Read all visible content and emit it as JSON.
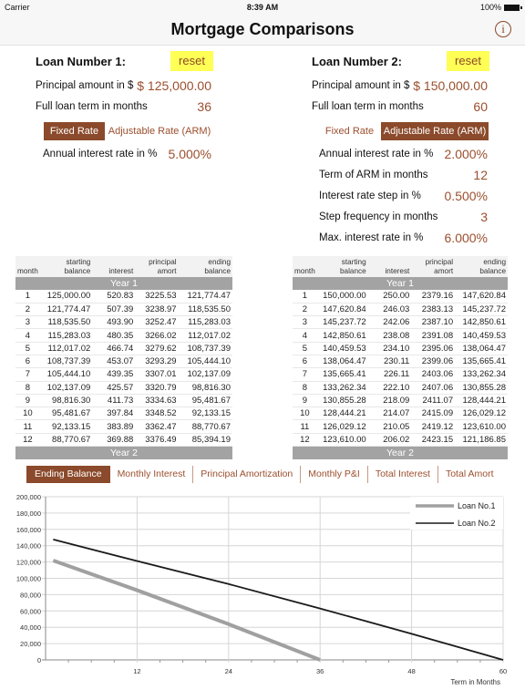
{
  "status_bar": {
    "carrier": "Carrier",
    "time": "8:39 AM",
    "battery": "100%"
  },
  "nav": {
    "title": "Mortgage Comparisons",
    "info_icon": "info-icon"
  },
  "loans": [
    {
      "title": "Loan Number 1:",
      "reset_label": "reset",
      "principal_label": "Principal amount in $",
      "principal_value": "$ 125,000.00",
      "term_label": "Full loan term in months",
      "term_value": "36",
      "rate_types": [
        "Fixed Rate",
        "Adjustable Rate (ARM)"
      ],
      "selected_rate_type": "Fixed Rate",
      "fields": [
        {
          "label": "Annual interest rate in %",
          "value": "5.000%"
        }
      ]
    },
    {
      "title": "Loan Number 2:",
      "reset_label": "reset",
      "principal_label": "Principal amount in $",
      "principal_value": "$ 150,000.00",
      "term_label": "Full loan term in months",
      "term_value": "60",
      "rate_types": [
        "Fixed Rate",
        "Adjustable Rate (ARM)"
      ],
      "selected_rate_type": "Adjustable Rate (ARM)",
      "fields": [
        {
          "label": "Annual interest rate in %",
          "value": "2.000%"
        },
        {
          "label": "Term of ARM in months",
          "value": "12"
        },
        {
          "label": "Interest rate step in %",
          "value": "0.500%"
        },
        {
          "label": "Step frequency in months",
          "value": "3"
        },
        {
          "label": "Max. interest rate in %",
          "value": "6.000%"
        }
      ]
    }
  ],
  "table_headers": [
    [
      "",
      "month"
    ],
    [
      "starting",
      "balance"
    ],
    [
      "",
      "interest"
    ],
    [
      "principal",
      "amort"
    ],
    [
      "ending",
      "balance"
    ]
  ],
  "tables": [
    {
      "year_labels": [
        "Year 1",
        "Year 2"
      ],
      "rows": [
        [
          "1",
          "125,000.00",
          "520.83",
          "3225.53",
          "121,774.47"
        ],
        [
          "2",
          "121,774.47",
          "507.39",
          "3238.97",
          "118,535.50"
        ],
        [
          "3",
          "118,535.50",
          "493.90",
          "3252.47",
          "115,283.03"
        ],
        [
          "4",
          "115,283.03",
          "480.35",
          "3266.02",
          "112,017.02"
        ],
        [
          "5",
          "112,017.02",
          "466.74",
          "3279.62",
          "108,737.39"
        ],
        [
          "6",
          "108,737.39",
          "453.07",
          "3293.29",
          "105,444.10"
        ],
        [
          "7",
          "105,444.10",
          "439.35",
          "3307.01",
          "102,137.09"
        ],
        [
          "8",
          "102,137.09",
          "425.57",
          "3320.79",
          "98,816.30"
        ],
        [
          "9",
          "98,816.30",
          "411.73",
          "3334.63",
          "95,481.67"
        ],
        [
          "10",
          "95,481.67",
          "397.84",
          "3348.52",
          "92,133.15"
        ],
        [
          "11",
          "92,133.15",
          "383.89",
          "3362.47",
          "88,770.67"
        ],
        [
          "12",
          "88,770.67",
          "369.88",
          "3376.49",
          "85,394.19"
        ]
      ]
    },
    {
      "year_labels": [
        "Year 1",
        "Year 2"
      ],
      "rows": [
        [
          "1",
          "150,000.00",
          "250.00",
          "2379.16",
          "147,620.84"
        ],
        [
          "2",
          "147,620.84",
          "246.03",
          "2383.13",
          "145,237.72"
        ],
        [
          "3",
          "145,237.72",
          "242.06",
          "2387.10",
          "142,850.61"
        ],
        [
          "4",
          "142,850.61",
          "238.08",
          "2391.08",
          "140,459.53"
        ],
        [
          "5",
          "140,459.53",
          "234.10",
          "2395.06",
          "138,064.47"
        ],
        [
          "6",
          "138,064.47",
          "230.11",
          "2399.06",
          "135,665.41"
        ],
        [
          "7",
          "135,665.41",
          "226.11",
          "2403.06",
          "133,262.34"
        ],
        [
          "8",
          "133,262.34",
          "222.10",
          "2407.06",
          "130,855.28"
        ],
        [
          "9",
          "130,855.28",
          "218.09",
          "2411.07",
          "128,444.21"
        ],
        [
          "10",
          "128,444.21",
          "214.07",
          "2415.09",
          "126,029.12"
        ],
        [
          "11",
          "126,029.12",
          "210.05",
          "2419.12",
          "123,610.00"
        ],
        [
          "12",
          "123,610.00",
          "206.02",
          "2423.15",
          "121,186.85"
        ]
      ]
    }
  ],
  "chart_tabs": [
    "Ending Balance",
    "Monthly Interest",
    "Principal Amortization",
    "Monthly P&I",
    "Total Interest",
    "Total Amort"
  ],
  "selected_chart_tab": "Ending Balance",
  "colors": {
    "accent": "#8b4a2b",
    "value_text": "#9b4f2e",
    "reset_bg": "#ffff55",
    "loan1_line": "#a0a0a0",
    "loan2_line": "#1a1a1a"
  },
  "chart_data": {
    "type": "line",
    "title": "Ending Balance",
    "xlabel": "Term in Months",
    "ylabel": "",
    "xlim": [
      0,
      60
    ],
    "ylim": [
      0,
      200000
    ],
    "x_ticks": [
      "12",
      "24",
      "36",
      "48",
      "60"
    ],
    "y_ticks": [
      "0",
      "20,000",
      "40,000",
      "60,000",
      "80,000",
      "100,000",
      "120,000",
      "140,000",
      "160,000",
      "180,000",
      "200,000"
    ],
    "legend_position": "top-right",
    "grid": true,
    "series": [
      {
        "name": "Loan No.1",
        "x": [
          1,
          12,
          24,
          36
        ],
        "values": [
          121774,
          85394,
          43800,
          0
        ]
      },
      {
        "name": "Loan No.2",
        "x": [
          1,
          12,
          24,
          36,
          48,
          60
        ],
        "values": [
          147621,
          121187,
          93000,
          63000,
          32000,
          0
        ]
      }
    ]
  }
}
